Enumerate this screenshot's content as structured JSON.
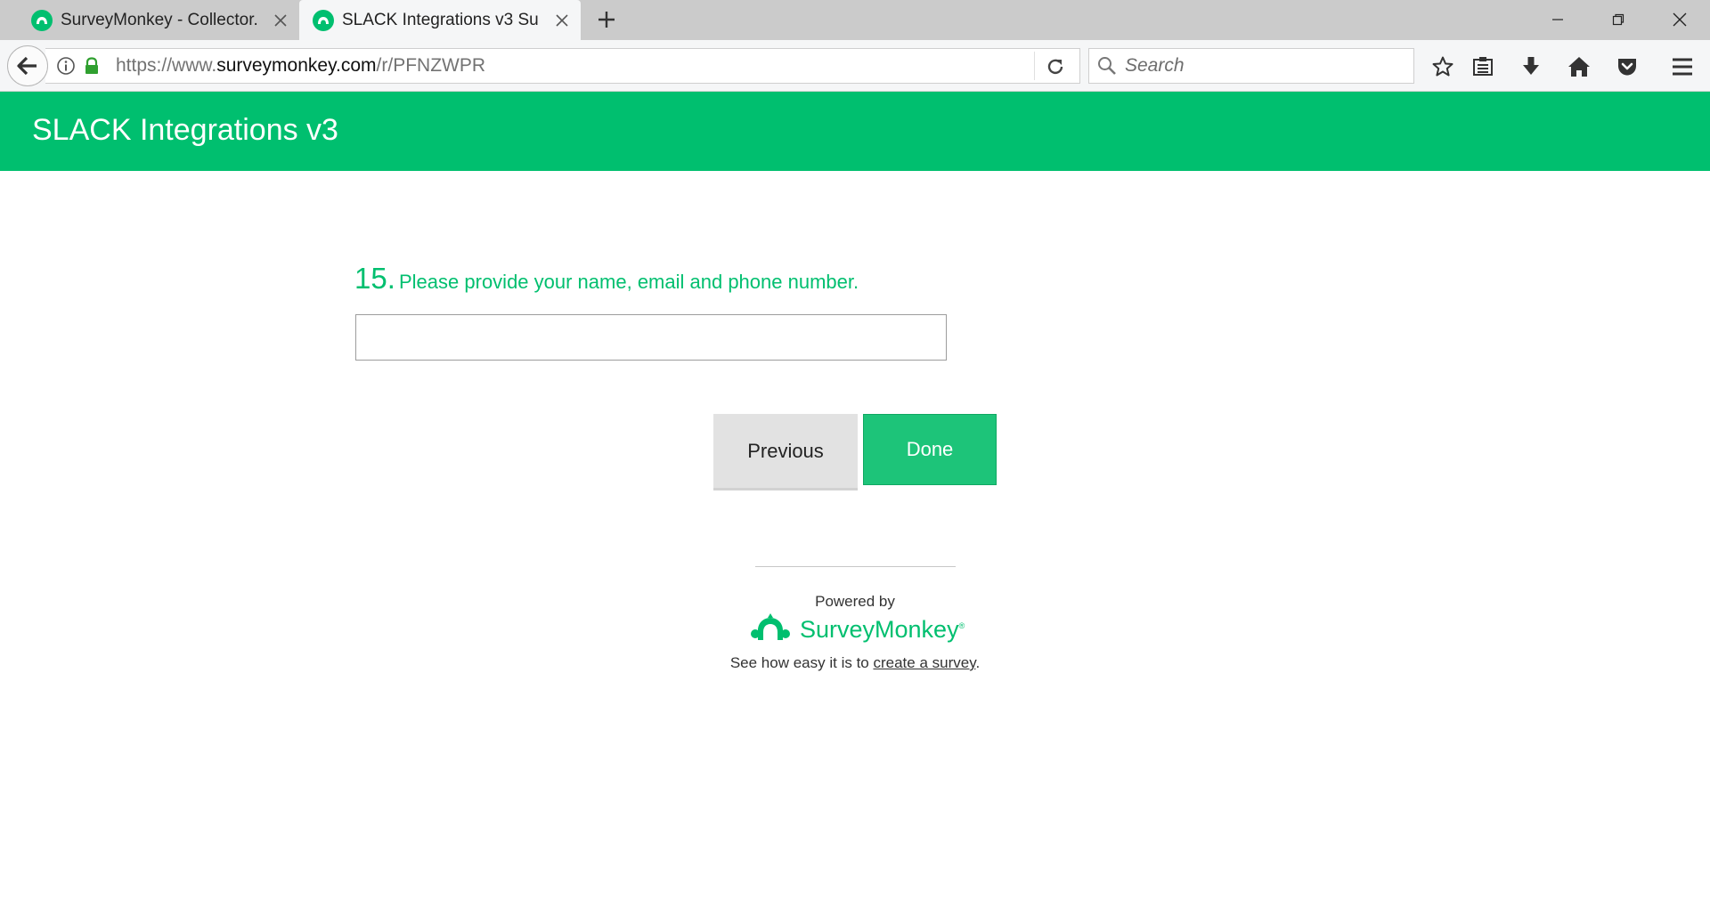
{
  "browser": {
    "tabs": [
      {
        "title": "SurveyMonkey - Collector...",
        "active": false
      },
      {
        "title": "SLACK Integrations v3 Sur...",
        "active": true
      }
    ],
    "url_prefix": "https://www.",
    "url_host": "surveymonkey.com",
    "url_path": "/r/PFNZWPR",
    "search_placeholder": "Search"
  },
  "survey": {
    "title": "SLACK Integrations v3",
    "question_number": "15.",
    "question_text": "Please provide your name, email and phone number.",
    "answer_value": "",
    "previous_label": "Previous",
    "done_label": "Done"
  },
  "footer": {
    "powered_by": "Powered by",
    "brand": "SurveyMonkey",
    "brand_mark": "®",
    "cta_prefix": "See how easy it is to ",
    "cta_link": "create a survey",
    "cta_suffix": "."
  },
  "colors": {
    "brand_green": "#00bf6f",
    "tabstrip_bg": "#cbcbcb",
    "toolbar_bg": "#f5f6f7"
  },
  "icons": [
    "surveymonkey-favicon",
    "close-icon",
    "plus-icon",
    "minimize-icon",
    "restore-icon",
    "window-close-icon",
    "back-arrow-icon",
    "info-icon",
    "lock-icon",
    "reload-icon",
    "search-icon",
    "star-icon",
    "reading-list-icon",
    "download-icon",
    "home-icon",
    "pocket-icon",
    "hamburger-menu-icon",
    "surveymonkey-logo-icon"
  ]
}
